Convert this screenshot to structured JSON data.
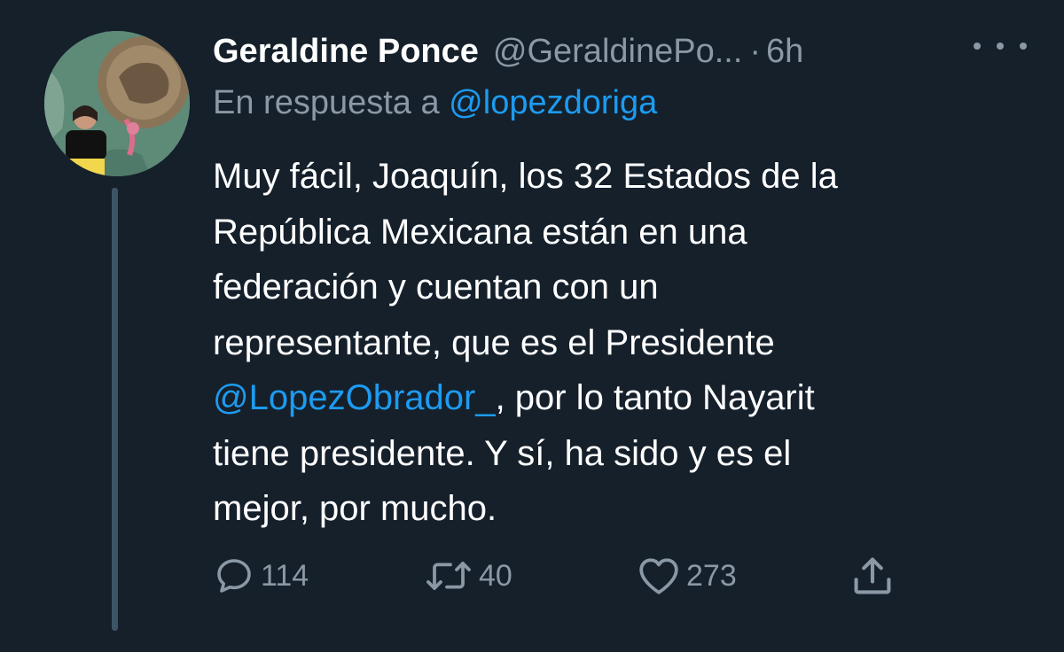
{
  "author": {
    "display_name": "Geraldine Ponce",
    "handle": "@GeraldinePo...",
    "separator": "·",
    "time": "6h"
  },
  "reply_to": {
    "prefix": "En respuesta a",
    "mention": "@lopezdoriga"
  },
  "body": {
    "line1": "Muy fácil, Joaquín, los 32 Estados de la",
    "line2": "República Mexicana están en una",
    "line3": "federación y cuentan con un",
    "line4": "representante, que es el Presidente",
    "line5_mention": "@LopezObrador_",
    "line5_rest": ", por lo tanto Nayarit",
    "line6": "tiene presidente. Y sí, ha sido y es el",
    "line7": "mejor, por mucho."
  },
  "actions": {
    "replies": "114",
    "retweets": "40",
    "likes": "273"
  },
  "icons": {
    "more": "more-options-icon",
    "reply": "reply-icon",
    "retweet": "retweet-icon",
    "like": "heart-icon",
    "share": "share-icon"
  },
  "colors": {
    "background": "#15202b",
    "text": "#ffffff",
    "secondary": "#8b98a5",
    "link": "#1d9bf0"
  }
}
